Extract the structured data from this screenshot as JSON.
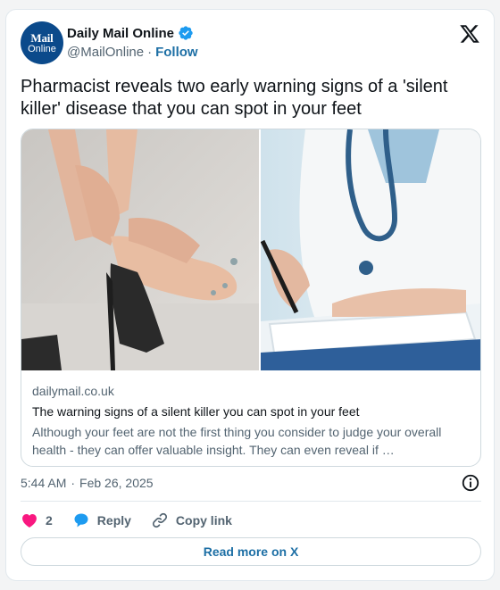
{
  "author": {
    "display_name": "Daily Mail Online",
    "handle": "@MailOnline",
    "separator": "·",
    "follow_label": "Follow",
    "avatar_line1": "Mail",
    "avatar_line2": "Online",
    "avatar_color": "#0b4a8b",
    "verified_icon": "verified-badge-icon"
  },
  "tweet": {
    "text": "Pharmacist reveals two early warning signs of a 'silent killer' disease that you can spot in your feet"
  },
  "link_card": {
    "domain": "dailymail.co.uk",
    "title": "The warning signs of a silent killer you can spot in your feet",
    "description": "Although your feet are not the first thing you consider to judge your overall health - they can offer valuable insight. They can even reveal if …"
  },
  "meta": {
    "time": "5:44 AM",
    "separator": "·",
    "date": "Feb 26, 2025"
  },
  "actions": {
    "likes_count": "2",
    "reply_label": "Reply",
    "copy_link_label": "Copy link"
  },
  "read_more_label": "Read more on X",
  "colors": {
    "accent": "#1d6fa5",
    "heart": "#f91880",
    "secondary_text": "#536471"
  }
}
